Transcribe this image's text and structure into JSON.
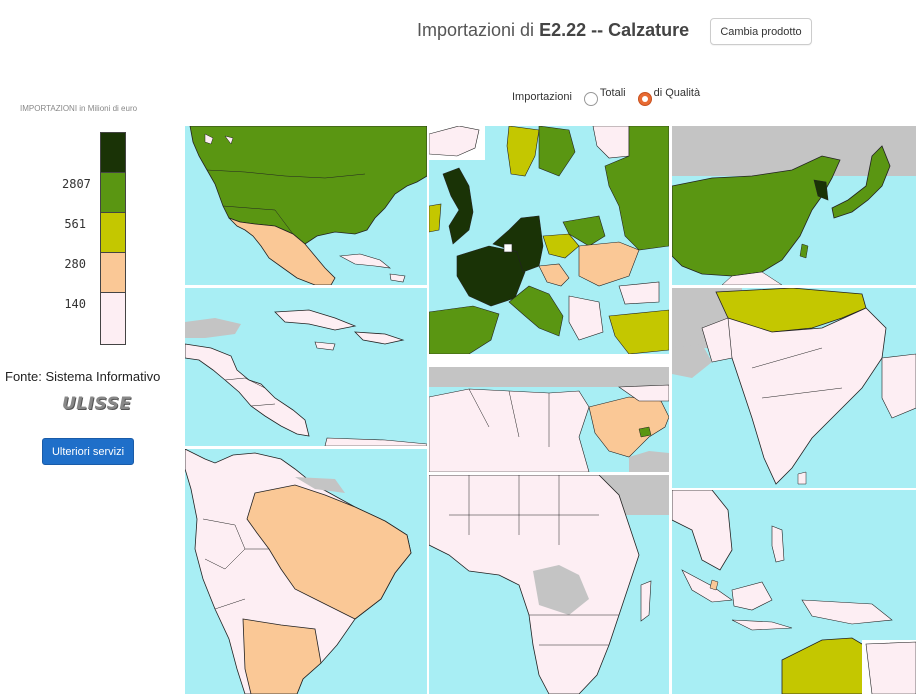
{
  "header": {
    "title_prefix": "Importazioni di ",
    "title_product": "E2.22 -- Calzature",
    "change_button": "Cambia prodotto"
  },
  "filter": {
    "label": "Importazioni",
    "options": [
      "Totali",
      "di Qualità"
    ],
    "selected": "di Qualità"
  },
  "legend": {
    "title": "IMPORTAZIONI  in Milioni di euro",
    "thresholds": [
      "2807",
      "561",
      "280",
      "140"
    ],
    "colors": [
      "#1a3306",
      "#5a9612",
      "#c4c700",
      "#fac896",
      "#fdeef3"
    ]
  },
  "sidebar": {
    "source": "Fonte: Sistema Informativo",
    "logo": "ULISSE",
    "services_button": "Ulteriori servizi"
  },
  "map": {
    "ocean_color": "#a8eef4",
    "nodata_color": "#c4c4c4",
    "regions": [
      "north-america",
      "caribbean-central-america",
      "south-america",
      "europe",
      "north-africa-middle-east",
      "sub-saharan-africa",
      "east-asia",
      "south-asia",
      "south-east-asia-oceania"
    ]
  }
}
